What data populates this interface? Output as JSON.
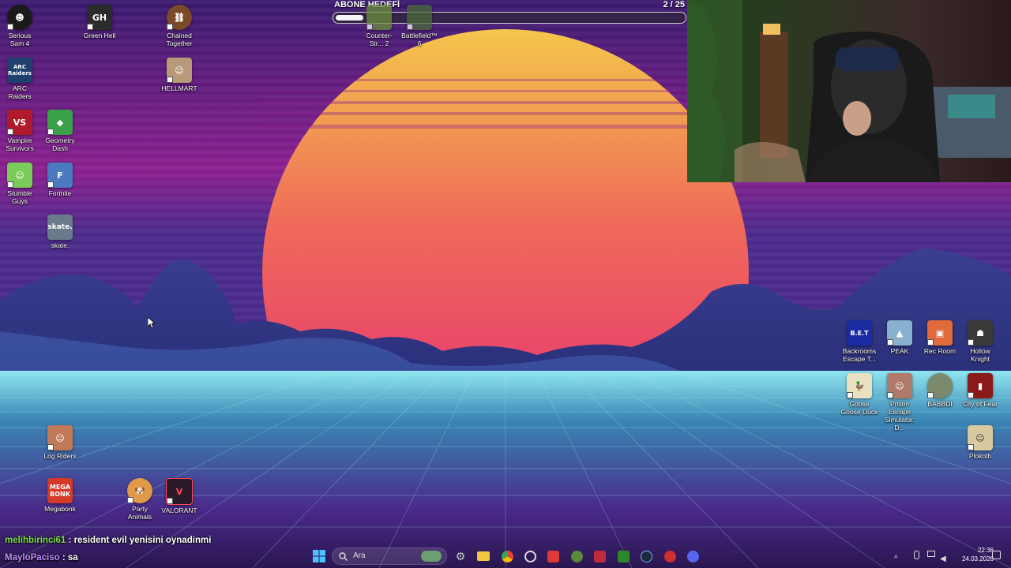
{
  "sub_goal": {
    "title": "ABONE HEDEFİ",
    "count": "2 / 25",
    "progress_fraction": 0.08
  },
  "desktop_icons": {
    "serious_sam": "Serious Sam 4",
    "green_hell": "Green Hell",
    "chained_together": "Chained Together",
    "counter_strike": "Counter-Str... 2",
    "battlefield": "Battlefield™ 6",
    "arc_raiders": "ARC Raiders",
    "hellmart": "HELLMART",
    "vampire_survivors": "Vampire Survivors",
    "geometry_dash": "Geometry Dash",
    "stumble_guys": "Stumble Guys",
    "fortnite": "Fortnite",
    "skate": "skate.",
    "log_riders": "Log Riders",
    "megabonk": "Megabonk",
    "party_animals": "Party Animals",
    "valorant": "VALORANT",
    "backrooms": "Backrooms Escape T...",
    "peak": "PEAK",
    "rec_room": "Rec Room",
    "hollow_knight": "Hollow Knight",
    "goose_goose_duck": "Goose Goose Duck",
    "prison_escape": "Prison Escape Simulator: D...",
    "babbdi": "BABBDI",
    "city_of_fear": "City of Fear",
    "plokoth": "Plokoth"
  },
  "icon_texts": {
    "megabonk_logo": "MEGA BONK",
    "bet_logo": "B.E.T",
    "skate_logo": "skate.",
    "arc_logo": "ARC Raiders"
  },
  "chat": [
    {
      "user": "melihbirinci61",
      "message": " : resident evil yenisini oynadinmi"
    },
    {
      "user": "MayloPaciso",
      "message": " : sa"
    }
  ],
  "taskbar": {
    "search_placeholder": "Ara",
    "time": "22:36",
    "date": "24.03.2026"
  },
  "colors": {
    "sky_top": "#3a1a6e",
    "sun_top": "#f4c64b",
    "sun_bottom": "#e0207a",
    "grid": "#7fd6e6",
    "chat_user1": "#7fe04a",
    "chat_user2": "#c08cff"
  }
}
